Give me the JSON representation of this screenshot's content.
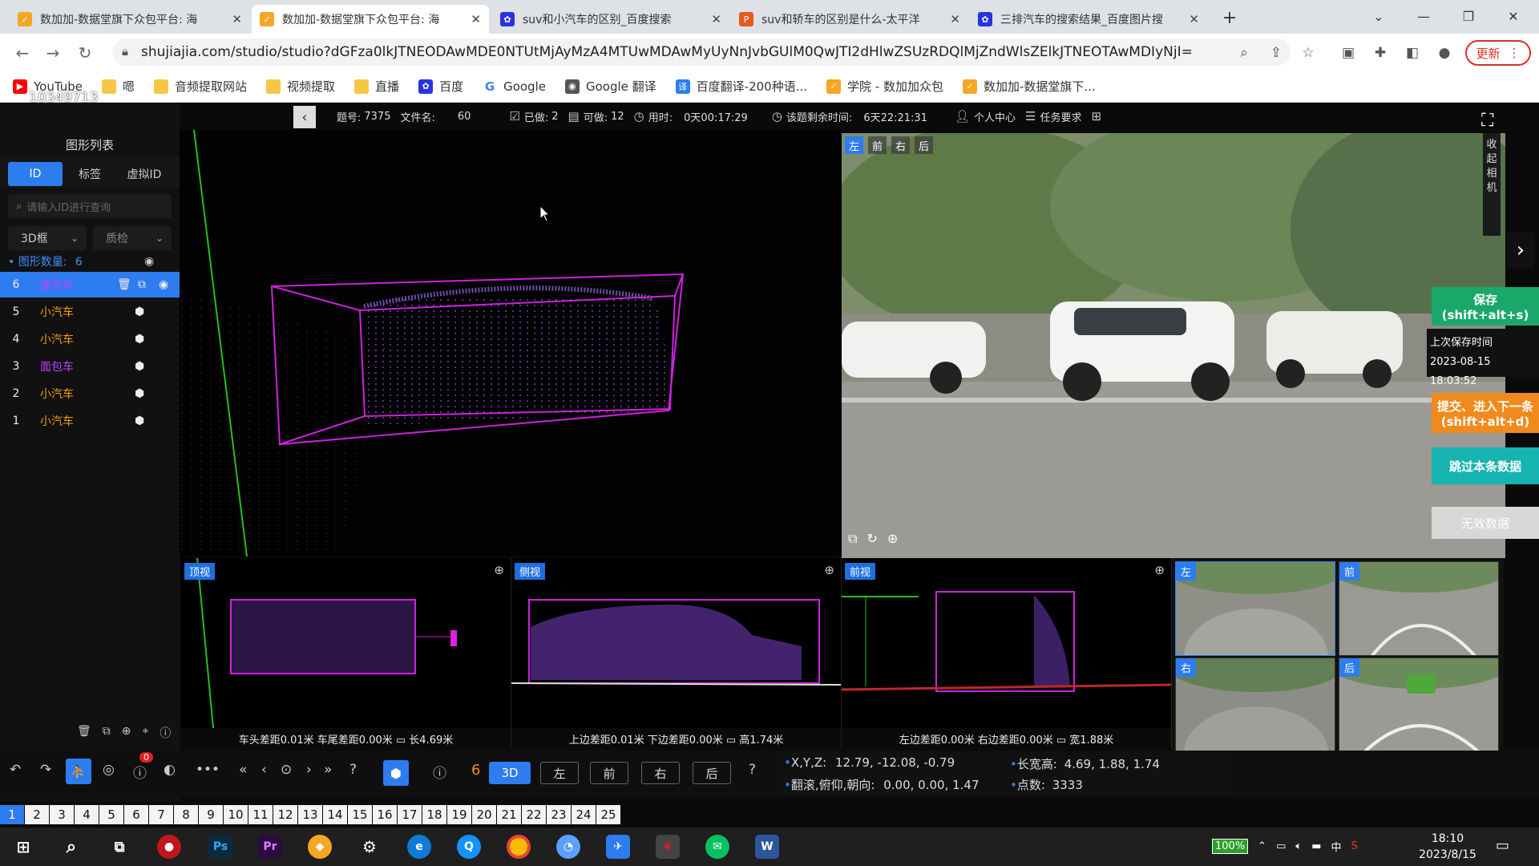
{
  "browser": {
    "tabs": [
      {
        "title": "数加加-数据堂旗下众包平台: 海",
        "active": false,
        "icon_color": "#f5a623"
      },
      {
        "title": "数加加-数据堂旗下众包平台: 海",
        "active": true,
        "icon_color": "#f5a623"
      },
      {
        "title": "suv和小汽车的区别_百度搜索",
        "active": false,
        "icon_color": "#2932e1"
      },
      {
        "title": "suv和轿车的区别是什么-太平洋",
        "active": false,
        "icon_color": "#e55a1c"
      },
      {
        "title": "三排汽车的搜索结果_百度图片搜",
        "active": false,
        "icon_color": "#2932e1"
      }
    ],
    "new_tab": "+",
    "url": "shujiajia.com/studio/studio?dGFza0lkJTNEODAwMDE0NTUtMjAyMzA4MTUwMDAwMyUyNnJvbGUlM0QwJTI2dHlwZSUzRDQlMjZndWlsZElkJTNEOTAwMDIyNjI=",
    "update_label": "更新",
    "bookmarks": [
      {
        "label": "YouTube",
        "color": "#ff0000"
      },
      {
        "label": "嗯",
        "color": "#f6c644"
      },
      {
        "label": "音频提取网站",
        "color": "#f6c644"
      },
      {
        "label": "视频提取",
        "color": "#f6c644"
      },
      {
        "label": "直播",
        "color": "#f6c644"
      },
      {
        "label": "百度",
        "color": "#2932e1"
      },
      {
        "label": "Google",
        "color": "#4285f4"
      },
      {
        "label": "Google 翻译",
        "color": "#555555"
      },
      {
        "label": "百度翻译-200种语...",
        "color": "#2d7cf0"
      },
      {
        "label": "学院 - 数加加众包",
        "color": "#f5a623"
      },
      {
        "label": "数加加-数据堂旗下...",
        "color": "#f5a623"
      }
    ],
    "overlay_id": "10349713"
  },
  "toolbar": {
    "item_no_label": "题号:",
    "item_no": "7375",
    "file_label": "文件名:",
    "file_name": "60",
    "done_label": "已做:",
    "done": "2",
    "available_label": "可做:",
    "available": "12",
    "time_used_label": "用时:",
    "time_used": "0天00:17:29",
    "remaining_label": "该题剩余时间:",
    "remaining": "6天22:21:31",
    "personal_center": "个人中心",
    "task_requirements": "任务要求"
  },
  "sidebar": {
    "title": "图形列表",
    "tabs": [
      "ID",
      "标签",
      "虚拟ID"
    ],
    "search_placeholder": "请输入ID进行查询",
    "filter_type": "3D框",
    "filter_check": "质检",
    "count_label": "图形数量:",
    "count": "6",
    "rows": [
      {
        "id": "6",
        "label": "面包车",
        "selected": true
      },
      {
        "id": "5",
        "label": "小汽车",
        "selected": false
      },
      {
        "id": "4",
        "label": "小汽车",
        "selected": false
      },
      {
        "id": "3",
        "label": "面包车",
        "selected": false
      },
      {
        "id": "2",
        "label": "小汽车",
        "selected": false
      },
      {
        "id": "1",
        "label": "小汽车",
        "selected": false
      }
    ]
  },
  "camera": {
    "tabs": [
      "左",
      "前",
      "右",
      "后"
    ],
    "active_tab": "左",
    "collapse_label": "收起相机"
  },
  "actions": {
    "save": "保存",
    "save_key": "(shift+alt+s)",
    "last_save_label": "上次保存时间",
    "last_save_time": "2023-08-15 18:03:52",
    "submit": "提交、进入下一条",
    "submit_key": "(shift+alt+d)",
    "skip": "跳过本条数据",
    "invalid": "无效数据"
  },
  "subviews": {
    "top": {
      "label": "顶视",
      "info": "车头差距0.01米 车尾差距0.00米 ▭ 长4.69米"
    },
    "side": {
      "label": "侧视",
      "info": "上边差距0.01米 下边差距0.00米 ▭ 高1.74米"
    },
    "front": {
      "label": "前视",
      "info": "左边差距0.00米 右边差距0.00米 ▭ 宽1.88米"
    }
  },
  "thumbs": [
    "左",
    "前",
    "右",
    "后"
  ],
  "bottom": {
    "badge_count": "0",
    "selected_id": "6",
    "mode_3d": "3D",
    "view_buttons": [
      "左",
      "前",
      "右",
      "后"
    ],
    "xyz_label": "X,Y,Z:",
    "xyz": "12.79, -12.08, -0.79",
    "lwh_label": "长宽高:",
    "lwh": "4.69, 1.88, 1.74",
    "rpy_label": "翻滚,俯仰,朝向:",
    "rpy": "0.00, 0.00, 1.47",
    "points_label": "点数:",
    "points": "3333"
  },
  "frames": [
    "1",
    "2",
    "3",
    "4",
    "5",
    "6",
    "7",
    "8",
    "9",
    "10",
    "11",
    "12",
    "13",
    "14",
    "15",
    "16",
    "17",
    "18",
    "19",
    "20",
    "21",
    "22",
    "23",
    "24",
    "25"
  ],
  "taskbar": {
    "battery": "100%",
    "ime": "中",
    "time": "18:10",
    "date": "2023/8/15"
  },
  "colors": {
    "accent": "#2d7cf0",
    "box": "#d020e0",
    "label_orange": "#f39c12",
    "save_green": "#1aa86a",
    "submit_orange": "#f08a1c",
    "skip_teal": "#17b3b0"
  }
}
